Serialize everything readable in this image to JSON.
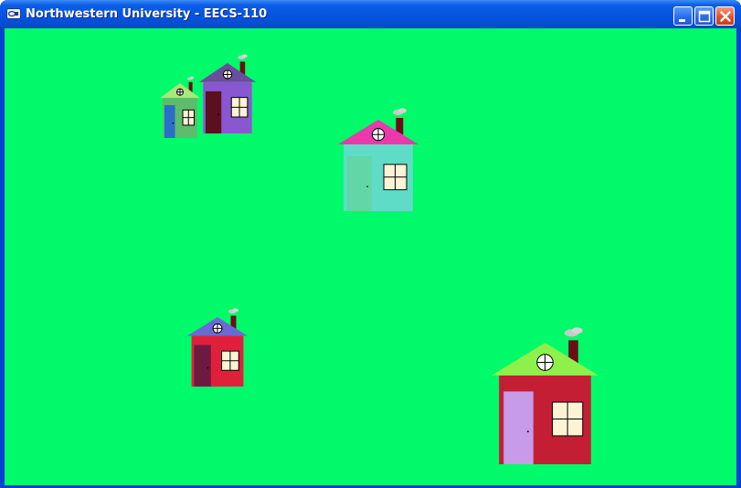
{
  "window": {
    "title": "Northwestern University - EECS-110"
  },
  "colors": {
    "titlebar": "#0754e0",
    "canvas_background": "#00fa6a"
  },
  "icons": {
    "app": "app-icon",
    "minimize": "minimize-icon",
    "maximize": "maximize-icon",
    "close": "close-icon"
  },
  "scene": {
    "houses": [
      {
        "name": "green-house",
        "wall": "#5dbd6c",
        "roof": "#a8e87a",
        "door": "#2a6ec8",
        "chimney": "#6b0e14"
      },
      {
        "name": "purple-house",
        "wall": "#8957cf",
        "roof": "#6a4e9c",
        "door": "#5b1020",
        "chimney": "#6b0e14"
      },
      {
        "name": "teal-house",
        "wall": "#5fdcc8",
        "roof": "#e83aaa",
        "door": "#62d6a6",
        "chimney": "#6b0e14"
      },
      {
        "name": "red-small-house",
        "wall": "#e0203a",
        "roof": "#6a6ad6",
        "door": "#6e1a40",
        "chimney": "#6b0e14"
      },
      {
        "name": "large-red-house",
        "wall": "#c41e35",
        "roof": "#8ef04a",
        "door": "#c79be8",
        "chimney": "#6b0e14"
      }
    ]
  }
}
